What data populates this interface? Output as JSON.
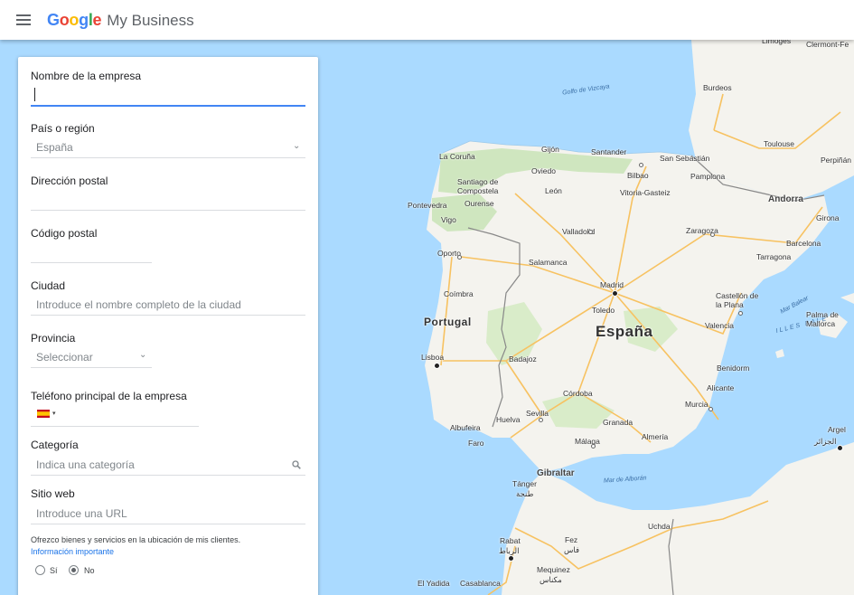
{
  "colors": {
    "sea": "#aadaff",
    "land": "#f4f3ee",
    "green": "#cfe6bf",
    "road": "#f7c261",
    "border": "#888888",
    "accent": "#4285f4",
    "link": "#1a73e8"
  },
  "header": {
    "menu_icon": "hamburger-menu-icon",
    "logo": {
      "google": [
        {
          "ch": "G",
          "color": "#4285f4"
        },
        {
          "ch": "o",
          "color": "#ea4335"
        },
        {
          "ch": "o",
          "color": "#fbbc05"
        },
        {
          "ch": "g",
          "color": "#4285f4"
        },
        {
          "ch": "l",
          "color": "#34a853"
        },
        {
          "ch": "e",
          "color": "#ea4335"
        }
      ],
      "product": "My Business"
    }
  },
  "form": {
    "business_name": {
      "label": "Nombre de la empresa",
      "value": ""
    },
    "country": {
      "label": "País o región",
      "value": "España"
    },
    "postal_address": {
      "label": "Dirección postal",
      "value": ""
    },
    "postal_code": {
      "label": "Código postal",
      "value": ""
    },
    "city": {
      "label": "Ciudad",
      "placeholder": "Introduce el nombre completo de la ciudad"
    },
    "province": {
      "label": "Provincia",
      "placeholder": "Seleccionar"
    },
    "phone": {
      "label": "Teléfono principal de la empresa",
      "value": ""
    },
    "category": {
      "label": "Categoría",
      "placeholder": "Indica una categoría"
    },
    "website": {
      "label": "Sitio web",
      "placeholder": "Introduce una URL"
    },
    "service_note": "Ofrezco bienes y servicios en la ubicación de mis clientes.",
    "info_link": "Información importante",
    "service_options": [
      {
        "label": "Sí",
        "selected": false
      },
      {
        "label": "No",
        "selected": true
      }
    ]
  },
  "map": {
    "countries": [
      "Portugal",
      "España"
    ],
    "regions": [
      "Andorra",
      "Gibraltar"
    ],
    "seas": [
      "Golfo de Vizcaya",
      "Mar Balear",
      "ILLES BALE",
      "Mar de Alborán"
    ],
    "cities": [
      "Limoges",
      "Clermont-Fe",
      "Burdeos",
      "Toulouse",
      "Perpiñán",
      "Gijón",
      "Santander",
      "San Sebastián",
      "La Coruña",
      "Oviedo",
      "Bilbao",
      "Pamplona",
      "Santiago de Compostela",
      "León",
      "Vitoria-Gasteiz",
      "Pontevedra",
      "Ourense",
      "Vigo",
      "Girona",
      "Valladolid",
      "Zaragoza",
      "Barcelona",
      "Oporto",
      "Tarragona",
      "Salamanca",
      "Madrid",
      "Coímbra",
      "Castellón de la Plana",
      "Toledo",
      "Valencia",
      "Palma de Mallorca",
      "Lisboa",
      "Badajoz",
      "Benidorm",
      "Alicante",
      "Córdoba",
      "Murcia",
      "Sevilla",
      "Huelva",
      "Albufeira",
      "Granada",
      "Almería",
      "Faro",
      "Málaga",
      "Argel",
      "الجزائر",
      "Tánger",
      "طنجة",
      "Uchda",
      "Rabat",
      "الرباط",
      "Fez",
      "فاس",
      "Mequinez",
      "مكناس",
      "El Yadida",
      "Casablanca"
    ]
  }
}
